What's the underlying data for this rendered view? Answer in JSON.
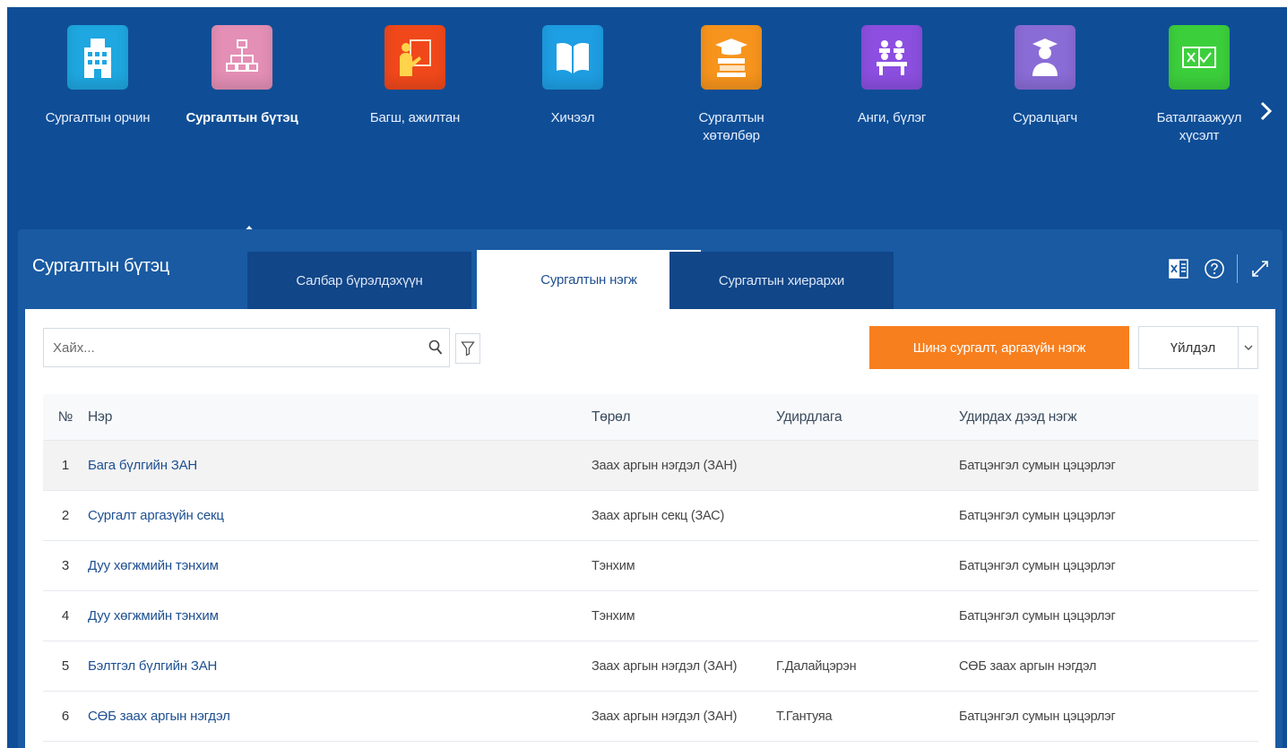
{
  "modules": [
    {
      "label": "Сургалтын орчин",
      "icon": "building-icon",
      "color": "#1ea7e0",
      "active": false
    },
    {
      "label": "Сургалтын бүтэц",
      "icon": "org-chart-icon",
      "color": "#e48fb5",
      "active": true
    },
    {
      "label": "Багш, ажилтан",
      "icon": "teacher-icon",
      "color": "#f0481b",
      "active": false
    },
    {
      "label": "Хичээл",
      "icon": "book-icon",
      "color": "#1e9ee3",
      "active": false
    },
    {
      "label": "Сургалтын хөтөлбөр",
      "icon": "books-graduation-icon",
      "color": "#f7941d",
      "active": false
    },
    {
      "label": "Анги, бүлэг",
      "icon": "classroom-icon",
      "color": "#8c4fe0",
      "active": false
    },
    {
      "label": "Суралцагч",
      "icon": "student-icon",
      "color": "#8a6cd6",
      "active": false
    },
    {
      "label": "Баталгаажуулсан хүсэлт",
      "label_lines": [
        "Баталгаажуулсан",
        "хүсэлт"
      ],
      "icon": "checkbox-icon",
      "color": "#3ccf3c",
      "active": false
    }
  ],
  "module_labels_display": {
    "m0": "Сургалтын орчин",
    "m1": "Сургалтын бүтэц",
    "m2": "Багш, ажилтан",
    "m3": "Хичээл",
    "m4a": "Сургалтын",
    "m4b": "хөтөлбөр",
    "m5": "Анги, бүлэг",
    "m6": "Суралцагч",
    "m7a": "Баталгаажуул",
    "m7b": "хүсэлт"
  },
  "panel": {
    "title": "Сургалтын бүтэц",
    "tabs": [
      {
        "label": "Салбар бүрэлдэхүүн",
        "active": false
      },
      {
        "label": "Сургалтын нэгж",
        "active": true
      },
      {
        "label": "Сургалтын хиерархи",
        "active": false
      }
    ]
  },
  "toolbar": {
    "search_placeholder": "Хайх...",
    "new_button_label": "Шинэ сургалт, аргазүйн нэгж",
    "action_label": "Үйлдэл"
  },
  "table": {
    "headers": {
      "no": "№",
      "name": "Нэр",
      "type": "Төрөл",
      "manager": "Удирдлага",
      "parent": "Удирдах дээд нэгж"
    },
    "rows": [
      {
        "no": "1",
        "name": "Бага бүлгийн ЗАН",
        "type": "Заах аргын нэгдэл (ЗАН)",
        "manager": "",
        "parent": "Батцэнгэл сумын цэцэрлэг"
      },
      {
        "no": "2",
        "name": "Сургалт аргазүйн секц",
        "type": "Заах аргын секц (ЗАС)",
        "manager": "",
        "parent": "Батцэнгэл сумын цэцэрлэг"
      },
      {
        "no": "3",
        "name": "Дуу хөгжмийн тэнхим",
        "type": "Тэнхим",
        "manager": "",
        "parent": "Батцэнгэл сумын цэцэрлэг"
      },
      {
        "no": "4",
        "name": "Дуу хөгжмийн тэнхим",
        "type": "Тэнхим",
        "manager": "",
        "parent": "Батцэнгэл сумын цэцэрлэг"
      },
      {
        "no": "5",
        "name": "Бэлтгэл бүлгийн ЗАН",
        "type": "Заах аргын нэгдэл (ЗАН)",
        "manager": "Г.Далайцэрэн",
        "parent": "СӨБ заах аргын нэгдэл"
      },
      {
        "no": "6",
        "name": "СӨБ заах аргын нэгдэл",
        "type": "Заах аргын нэгдэл (ЗАН)",
        "manager": "Т.Гантуяа",
        "parent": "Батцэнгэл сумын цэцэрлэг"
      }
    ]
  }
}
